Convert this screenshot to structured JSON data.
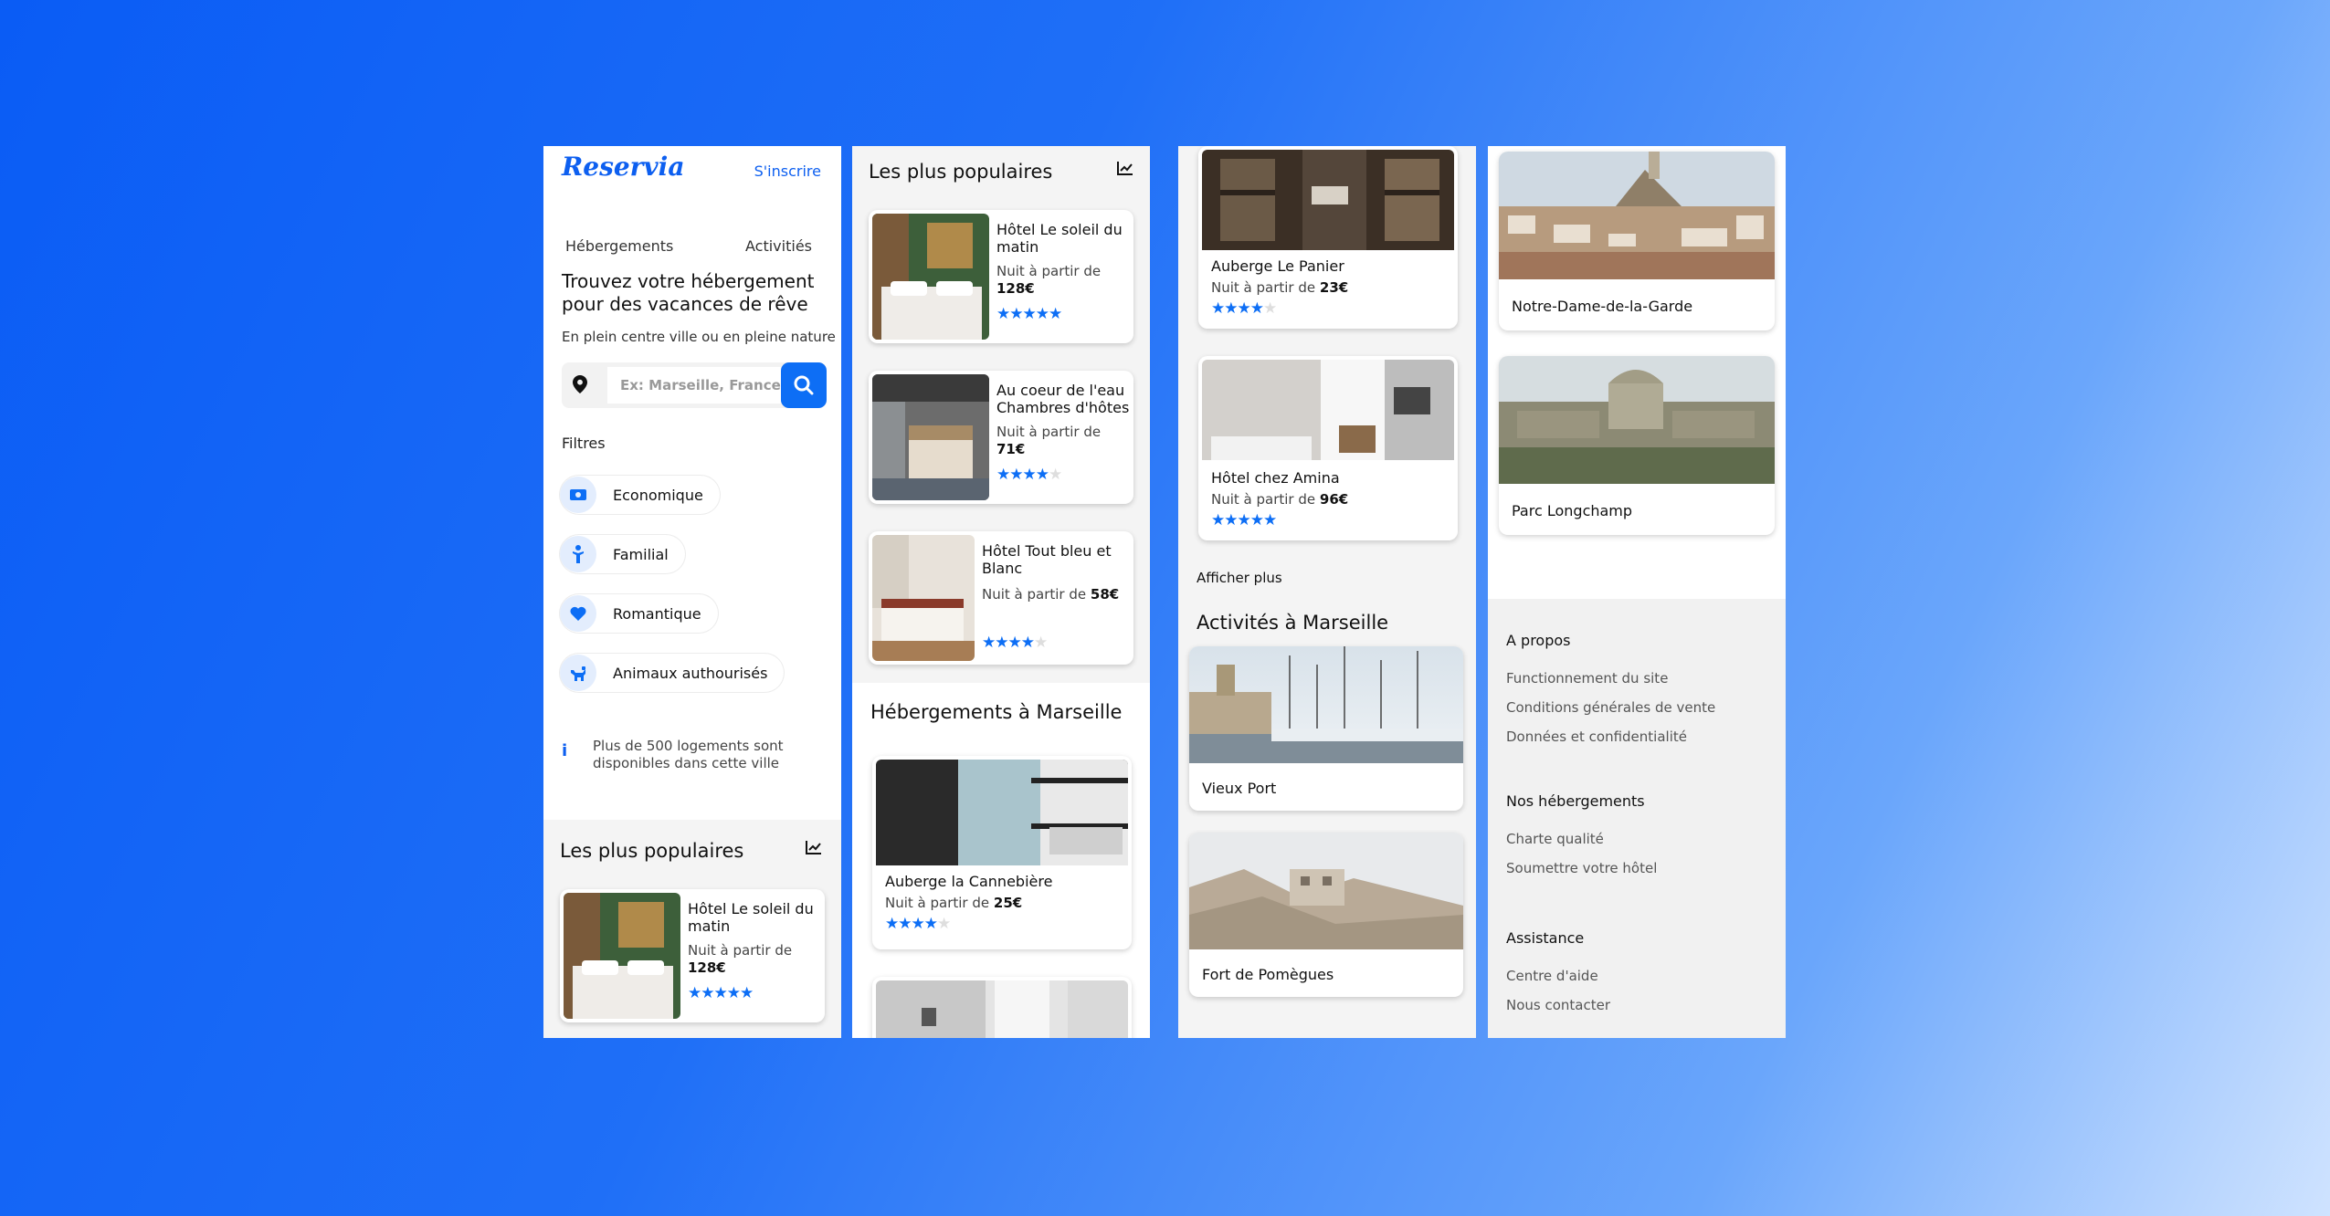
{
  "brand": {
    "logo": "Reservia",
    "signin": "S'inscrire",
    "accent": "#0d6ef5"
  },
  "tabs": [
    "Hébergements",
    "Activitiés"
  ],
  "hero": {
    "title": "Trouvez votre hébergement pour des vacances de rêve",
    "subtitle": "En plein centre ville ou en pleine nature"
  },
  "search": {
    "placeholder": "Ex: Marseille, France"
  },
  "filters": {
    "title": "Filtres",
    "items": [
      {
        "label": "Economique",
        "icon": "money-icon"
      },
      {
        "label": "Familial",
        "icon": "family-icon"
      },
      {
        "label": "Romantique",
        "icon": "heart-icon"
      },
      {
        "label": "Animaux authourisés",
        "icon": "pet-icon"
      }
    ]
  },
  "info_text": "Plus de 500 logements sont disponibles dans cette ville",
  "popular": {
    "title": "Les plus populaires",
    "price_prefix": "Nuit à partir de",
    "items": [
      {
        "name": "Hôtel Le soleil du matin",
        "price": "128€",
        "rating": 5
      },
      {
        "name": "Au coeur de l'eau Chambres d'hôtes",
        "price": "71€",
        "rating": 4
      },
      {
        "name": "Hôtel Tout bleu et Blanc",
        "price": "58€",
        "rating": 4
      }
    ]
  },
  "lodging": {
    "title": "Hébergements à Marseille",
    "items": [
      {
        "name": "Auberge la Cannebière",
        "price": "25€",
        "rating": 4
      },
      {
        "name": "Auberge Le Panier",
        "price": "23€",
        "rating": 4
      },
      {
        "name": "Hôtel chez Amina",
        "price": "96€",
        "rating": 5
      }
    ],
    "more": "Afficher plus"
  },
  "activities": {
    "title": "Activités à Marseille",
    "items": [
      "Vieux Port",
      "Fort de Pomègues",
      "Notre-Dame-de-la-Garde",
      "Parc Longchamp"
    ]
  },
  "footer": {
    "sections": [
      {
        "title": "A propos",
        "links": [
          "Functionnement du site",
          "Conditions générales de vente",
          "Données et confidentialité"
        ]
      },
      {
        "title": "Nos hébergements",
        "links": [
          "Charte qualité",
          "Soumettre votre hôtel"
        ]
      },
      {
        "title": "Assistance",
        "links": [
          "Centre d'aide",
          "Nous contacter"
        ]
      }
    ]
  }
}
